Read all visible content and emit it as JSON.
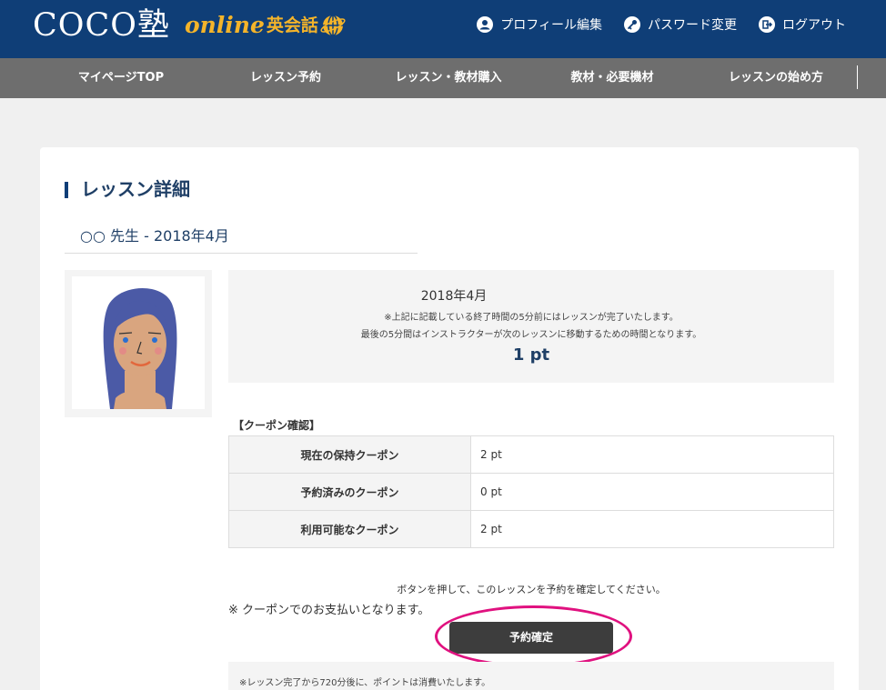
{
  "header": {
    "logo_main": "COCO塾",
    "logo_online": "online",
    "logo_eikaiwa": "英会話",
    "links": [
      {
        "label": "プロフィール編集",
        "icon": "user-icon"
      },
      {
        "label": "パスワード変更",
        "icon": "key-icon"
      },
      {
        "label": "ログアウト",
        "icon": "logout-icon"
      }
    ]
  },
  "nav": {
    "items": [
      "マイページTOP",
      "レッスン予約",
      "レッスン・教材購入",
      "教材・必要機材",
      "レッスンの始め方"
    ]
  },
  "main": {
    "title": "レッスン詳細",
    "teacher_line": "○○ 先生 - 2018年4月",
    "info": {
      "date": "2018年4月",
      "note1": "※上記に記載している終了時間の5分前にはレッスンが完了いたします。",
      "note2": "最後の5分間はインストラクターが次のレッスンに移動するための時間となります。",
      "points": "1 pt"
    },
    "coupon": {
      "title": "【クーポン確認】",
      "rows": [
        {
          "label": "現在の保持クーポン",
          "value": "2 pt"
        },
        {
          "label": "予約済みのクーポン",
          "value": "0 pt"
        },
        {
          "label": "利用可能なクーポン",
          "value": "2 pt"
        }
      ]
    },
    "instruction": "ボタンを押して、このレッスンを予約を確定してください。",
    "payment_note": "※ クーポンでのお支払いとなります。",
    "confirm_label": "予約確定",
    "footer_note": "※レッスン完了から720分後に、ポイントは消費いたします。"
  },
  "colors": {
    "header_bg": "#0f3e77",
    "nav_bg": "#6e6e6e",
    "accent": "#f4b42a",
    "highlight_ring": "#e0117f",
    "button_bg": "#3d3d3d"
  }
}
